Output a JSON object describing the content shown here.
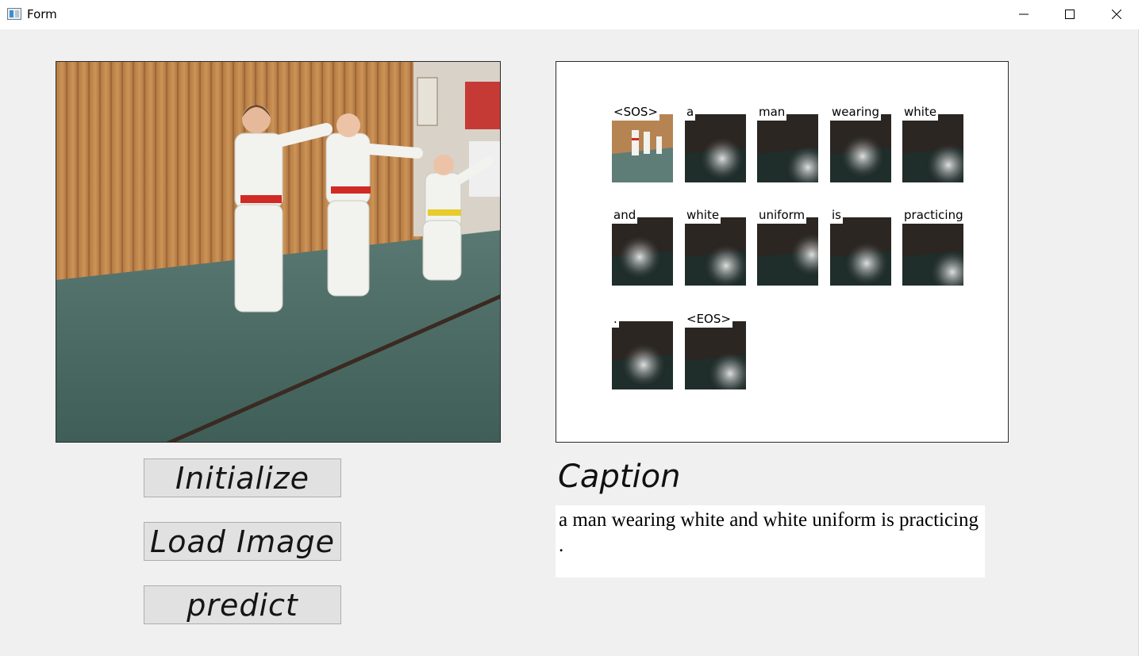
{
  "window": {
    "title": "Form",
    "controls": {
      "minimize": "minimize-icon",
      "maximize": "maximize-icon",
      "close": "close-icon"
    }
  },
  "buttons": {
    "initialize": "Initialize",
    "load_image": "Load Image",
    "predict": "predict"
  },
  "attention": {
    "words": [
      "<SOS>",
      "a",
      "man",
      "wearing",
      "white",
      "and",
      "white",
      "uniform",
      "is",
      "practicing",
      ".",
      "<EOS>"
    ]
  },
  "caption": {
    "title": "Caption",
    "text": "a man wearing white and white uniform is practicing ."
  },
  "colors": {
    "window_bg": "#f0f0f0",
    "button_bg": "#e1e1e1",
    "wood": "#c48a4e",
    "mat": "#4d6e68"
  }
}
